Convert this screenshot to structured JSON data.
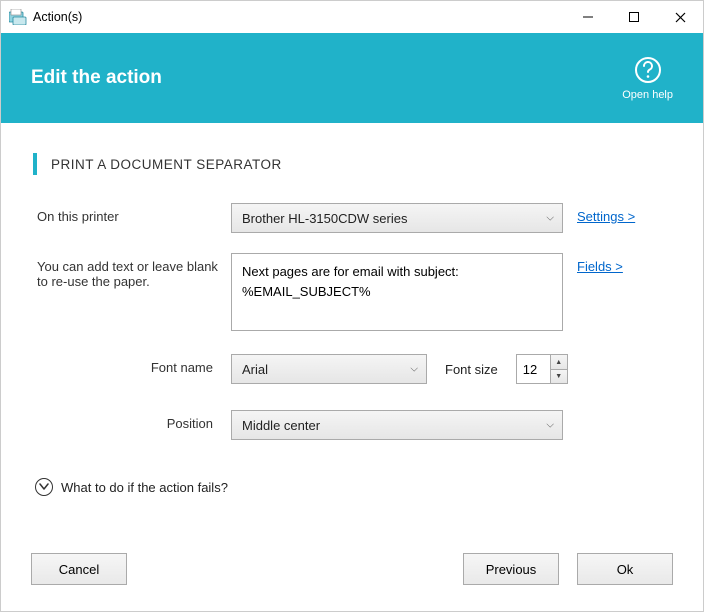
{
  "window": {
    "title": "Action(s)"
  },
  "header": {
    "heading": "Edit the action",
    "help_label": "Open help"
  },
  "section": {
    "title": "PRINT A DOCUMENT SEPARATOR"
  },
  "form": {
    "printer_label": "On this printer",
    "printer_value": "Brother HL-3150CDW series",
    "settings_link": "Settings >",
    "text_label": "You can add text or leave blank to re-use the paper.",
    "text_value": "Next pages are for email with subject: %EMAIL_SUBJECT%",
    "fields_link": "Fields >",
    "font_name_label": "Font name",
    "font_name_value": "Arial",
    "font_size_label": "Font size",
    "font_size_value": "12",
    "position_label": "Position",
    "position_value": "Middle center"
  },
  "expander": {
    "label": "What to do if the action fails?"
  },
  "buttons": {
    "cancel": "Cancel",
    "previous": "Previous",
    "ok": "Ok"
  },
  "colors": {
    "accent": "#20b2c9",
    "link": "#0066cc"
  }
}
